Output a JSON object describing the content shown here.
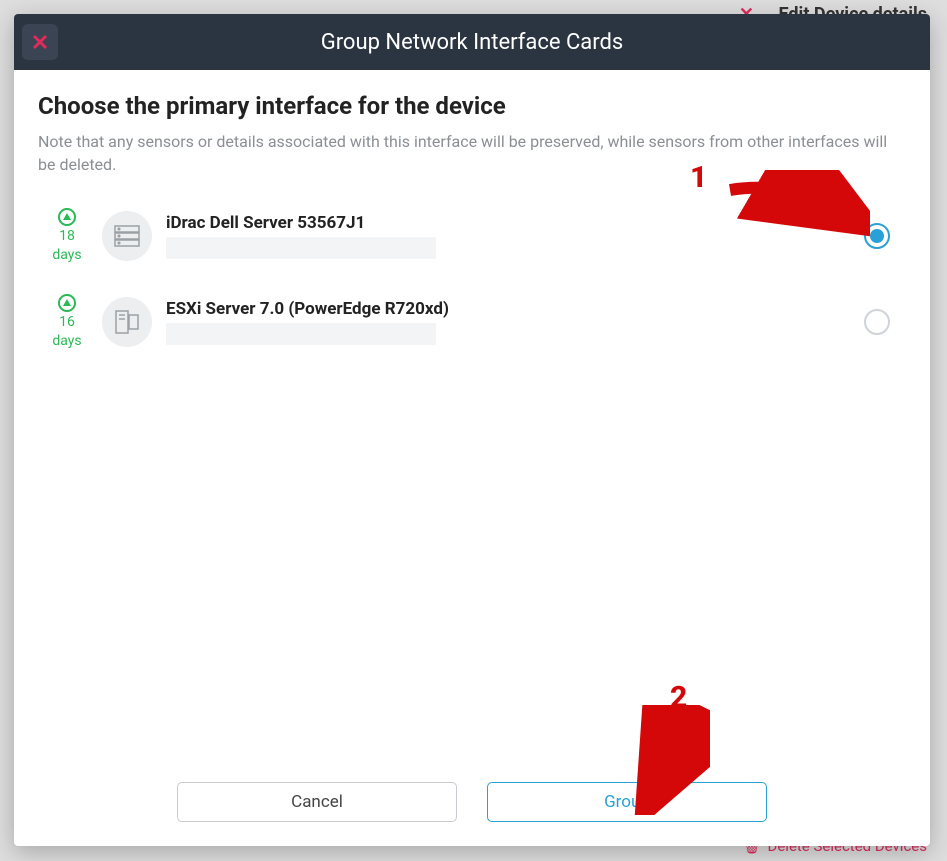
{
  "background": {
    "edit_label": "Edit Device details",
    "delete_label": "Delete Selected Devices"
  },
  "modal": {
    "title": "Group Network Interface Cards",
    "heading": "Choose the primary interface for the device",
    "subtext": "Note that any sensors or details associated with this interface will be preserved, while sensors from other interfaces will be deleted."
  },
  "options": [
    {
      "uptime_value": "18",
      "uptime_unit": "days",
      "name": "iDrac Dell Server 53567J1",
      "selected": true,
      "icon": "server-rack"
    },
    {
      "uptime_value": "16",
      "uptime_unit": "days",
      "name": "ESXi Server 7.0 (PowerEdge R720xd)",
      "selected": false,
      "icon": "vm-host"
    }
  ],
  "buttons": {
    "cancel": "Cancel",
    "confirm": "Group"
  },
  "annotations": {
    "step1": "1",
    "step2": "2"
  }
}
